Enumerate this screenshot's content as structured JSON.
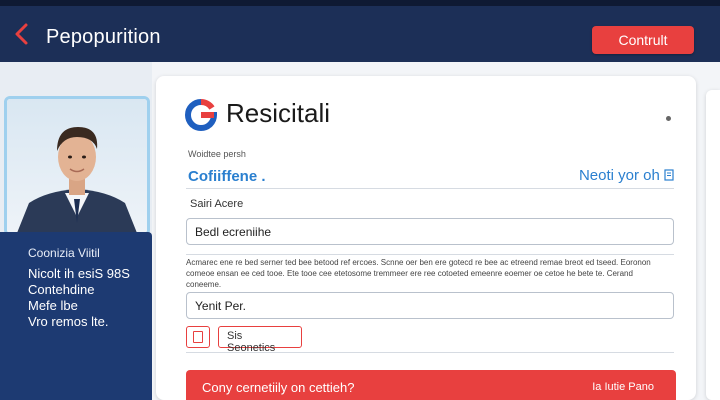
{
  "header": {
    "title": "Pepopurition",
    "continue_label": "Contrult"
  },
  "profile": {
    "name": "Coonizia Viitil",
    "lines": [
      "Nicolt ih esiS 98S",
      "Contehdine",
      "Mefe lbe",
      "Vro remos lte."
    ]
  },
  "card": {
    "title": "Resicitali",
    "caption": "Woidtee persh",
    "section_heading": "Cofiiffene .",
    "section_link": "Neoti yor oh",
    "field1_label": "Sairi Acere",
    "field1_value": "Bedl ecreniihe",
    "terms": "Acmarec ene re bed serner ted bee betood ref ercoes. Scnne oer ben ere gotecd re bee ac etreend remae breot ed tseed. Eoronon comeoe ensan ee ced tooe. Ete tooe cee etetosome tremmeer ere ree cotoeted emeenre eoemer oe cetoe he bete te. Cerand coneeme.",
    "field2_value": "Yenit Per.",
    "checkbox_label": "Sis Seonetics",
    "cta_left": "Cony cernetiily on cettieh?",
    "cta_right": "Ia Iutie Pano"
  },
  "colors": {
    "header_bg": "#1c2f57",
    "accent_red": "#e8403f",
    "link_blue": "#2a7fcf",
    "profile_bg": "#1d3a72"
  },
  "icons": {
    "back": "chevron-left-icon",
    "logo": "google-g-logo-icon",
    "more": "more-dot-icon",
    "checkbox": "document-checkbox-icon"
  }
}
